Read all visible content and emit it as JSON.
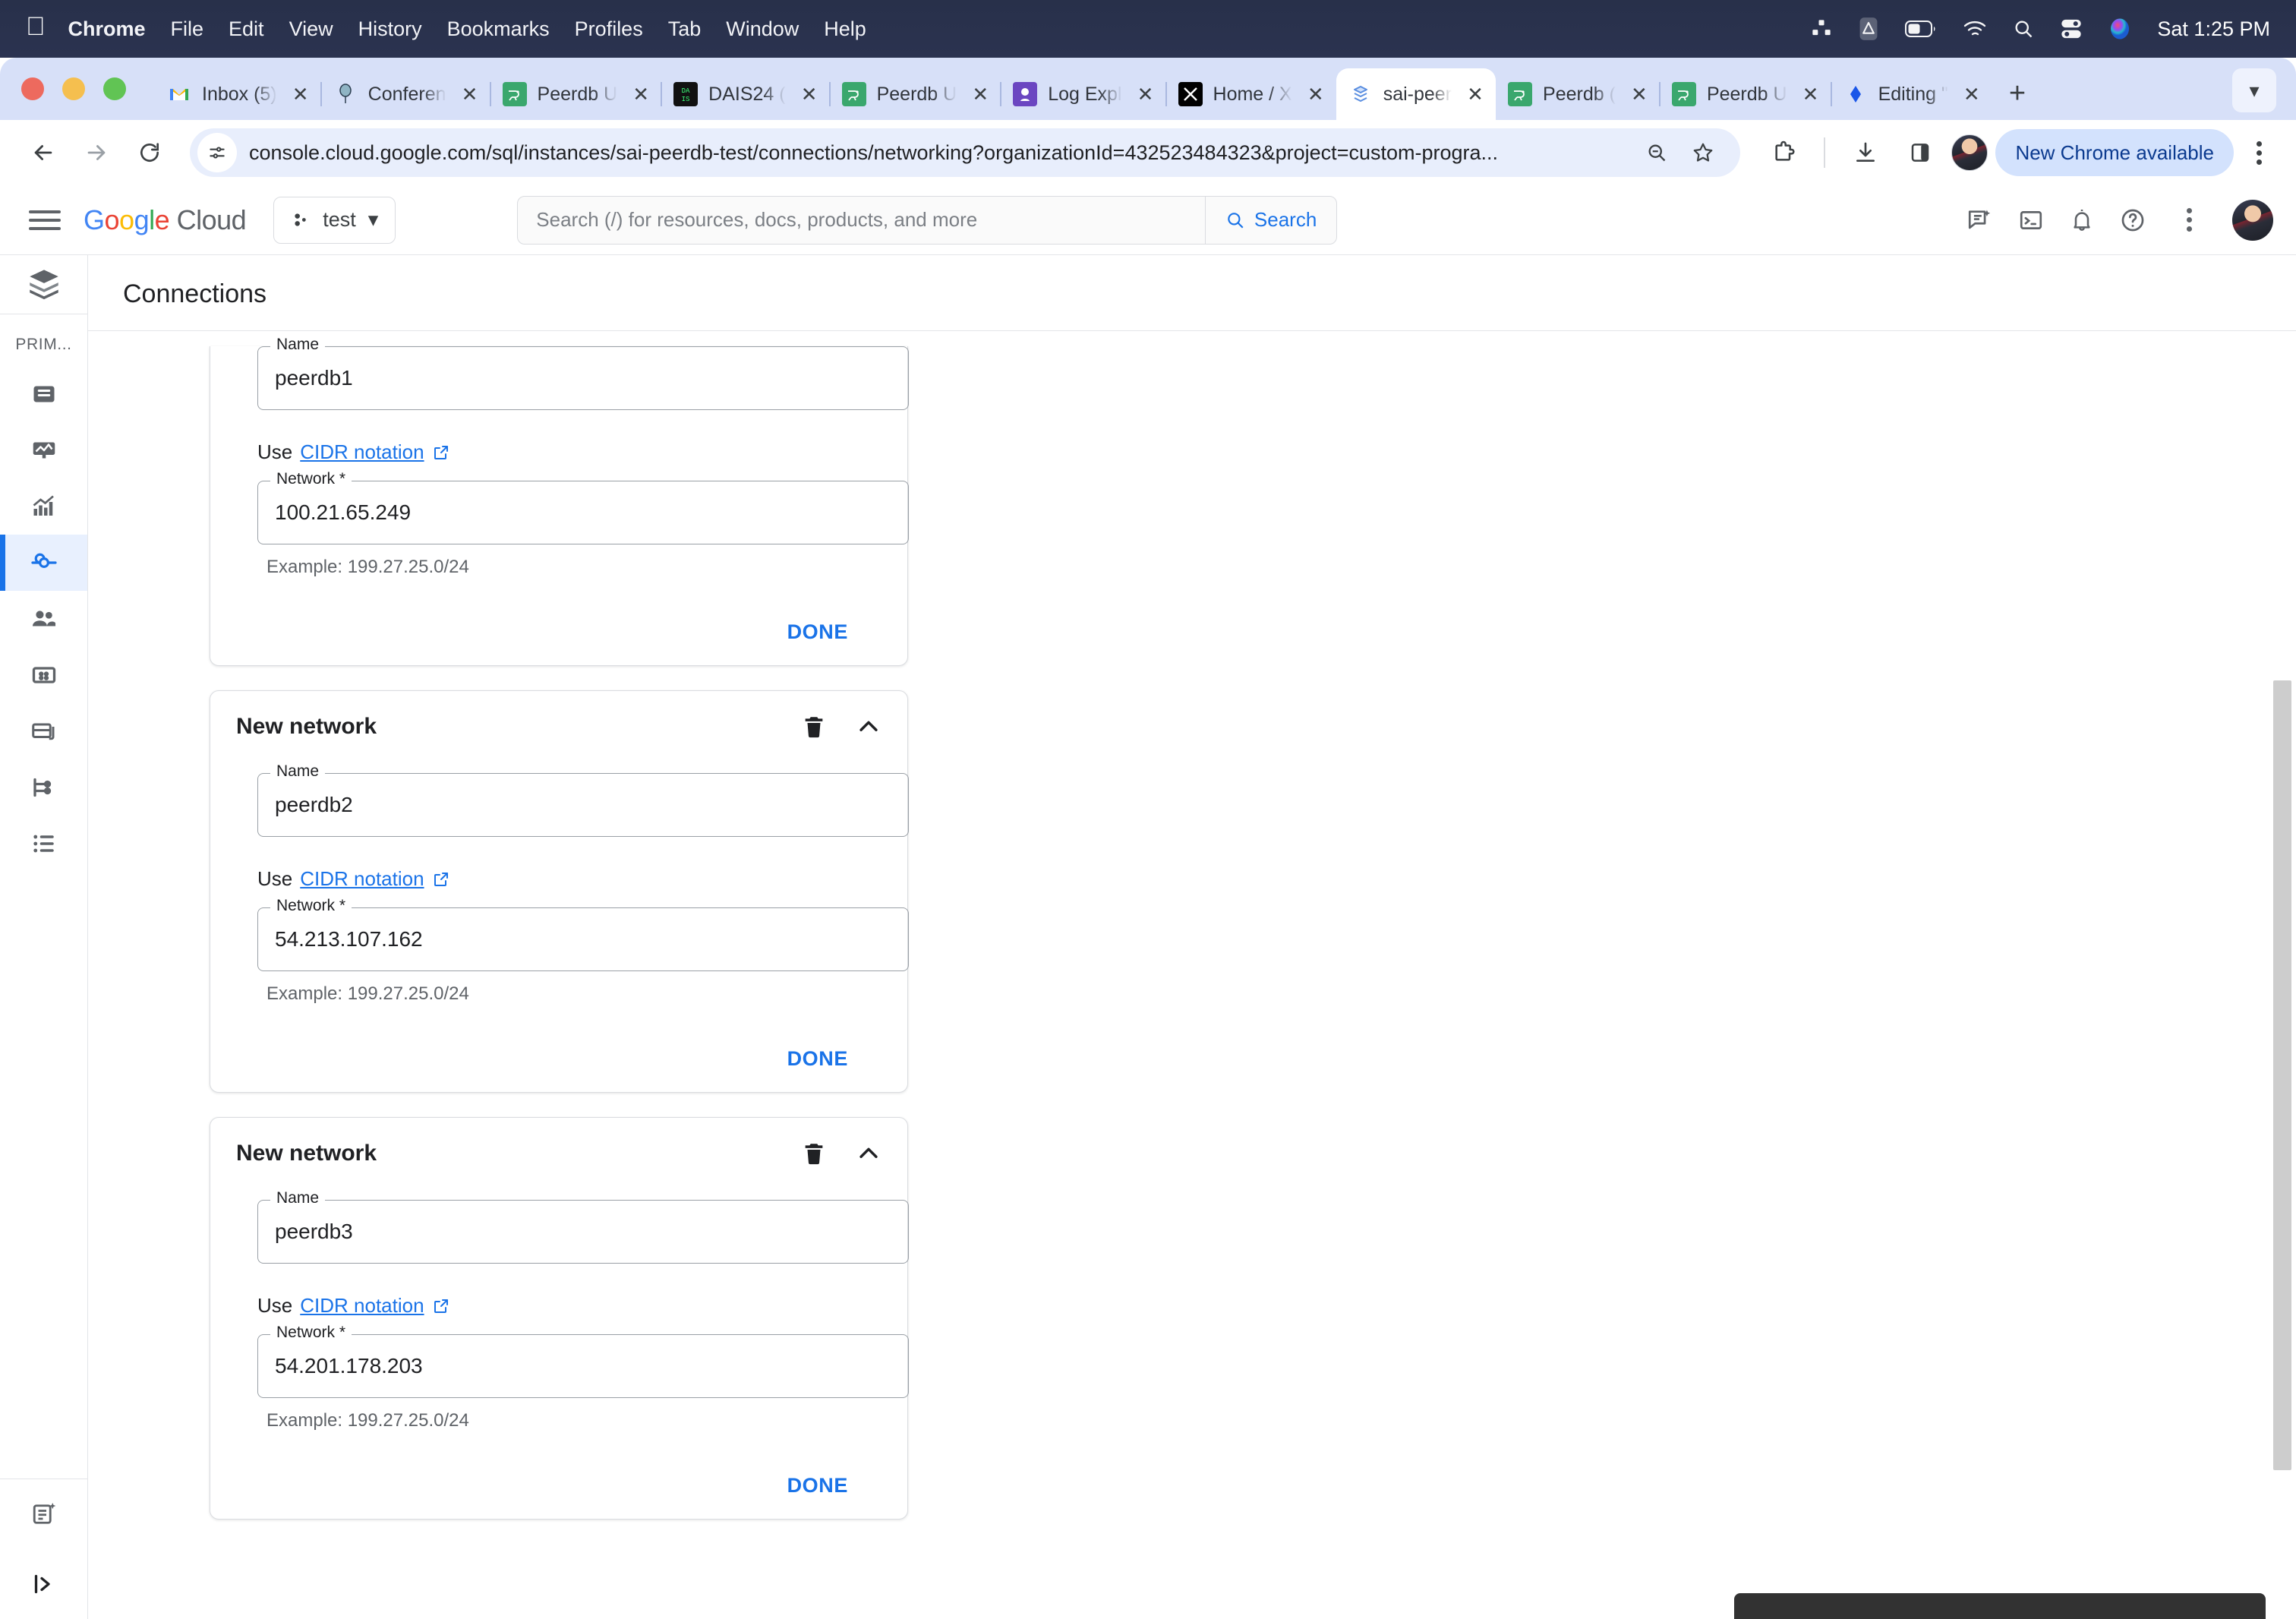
{
  "os_menubar": {
    "apple_icon": "apple-icon",
    "items": [
      "Chrome",
      "File",
      "Edit",
      "View",
      "History",
      "Bookmarks",
      "Profiles",
      "Tab",
      "Window",
      "Help"
    ],
    "status_icons": [
      "grid-icon",
      "app-icon",
      "battery-icon",
      "wifi-icon",
      "search-icon",
      "control-center-icon",
      "siri-icon"
    ],
    "clock": "Sat 1:25 PM"
  },
  "browser": {
    "traffic_lights": [
      "close-button",
      "minimize-button",
      "zoom-button"
    ],
    "tabs": [
      {
        "favicon": "gmail-icon",
        "label": "Inbox (5)",
        "active": false
      },
      {
        "favicon": "conference-icon",
        "label": "Conferen",
        "active": false
      },
      {
        "favicon": "peerdb-icon",
        "label": "Peerdb U",
        "active": false
      },
      {
        "favicon": "dais-icon",
        "label": "DAIS24 (",
        "active": false
      },
      {
        "favicon": "peerdb-icon",
        "label": "Peerdb U",
        "active": false
      },
      {
        "favicon": "logexplorer-icon",
        "label": "Log Expl",
        "active": false
      },
      {
        "favicon": "x-icon",
        "label": "Home / X",
        "active": false
      },
      {
        "favicon": "cloudsql-icon",
        "label": "sai-peer",
        "active": true
      },
      {
        "favicon": "peerdb-icon",
        "label": "Peerdb (",
        "active": false
      },
      {
        "favicon": "peerdb-icon",
        "label": "Peerdb U",
        "active": false
      },
      {
        "favicon": "editing-icon",
        "label": "Editing \"",
        "active": false
      }
    ],
    "new_tab_label": "+",
    "tab_list_chevron": "chevron-down-icon",
    "toolbar": {
      "back": "back-arrow-icon",
      "forward": "forward-arrow-icon",
      "reload": "reload-icon",
      "site_info": "site-settings-icon",
      "url": "console.cloud.google.com/sql/instances/sai-peerdb-test/connections/networking?organizationId=432523484323&project=custom-progra...",
      "zoom_icon": "zoom-out-icon",
      "bookmark_icon": "star-icon",
      "extensions_icon": "extensions-puzzle-icon",
      "downloads_icon": "download-icon",
      "sidepanel_icon": "side-panel-icon",
      "profile_icon": "profile-avatar",
      "update_label": "New Chrome available",
      "menu_icon": "kebab-menu-icon"
    }
  },
  "console_header": {
    "menu_icon": "hamburger-menu-icon",
    "logo": {
      "google": "Google",
      "cloud": "Cloud"
    },
    "project": {
      "icon": "project-icon",
      "name": "test",
      "chevron": "chevron-down-icon"
    },
    "search": {
      "placeholder": "Search (/) for resources, docs, products, and more",
      "button_label": "Search",
      "icon": "search-icon"
    },
    "right_icons": [
      "gemini-chat-icon",
      "cloud-shell-icon",
      "notifications-bell-icon",
      "help-question-icon",
      "kebab-menu-icon"
    ],
    "avatar": "user-avatar"
  },
  "sidebar": {
    "product_logo": "cloud-sql-icon",
    "section_label": "PRIM...",
    "items": [
      {
        "icon": "overview-icon",
        "name": "overview",
        "active": false
      },
      {
        "icon": "monitoring-icon",
        "name": "monitoring",
        "active": false
      },
      {
        "icon": "metrics-icon",
        "name": "metrics",
        "active": false
      },
      {
        "icon": "connections-icon",
        "name": "connections",
        "active": true
      },
      {
        "icon": "users-icon",
        "name": "users",
        "active": false
      },
      {
        "icon": "databases-icon",
        "name": "databases",
        "active": false
      },
      {
        "icon": "backups-icon",
        "name": "backups",
        "active": false
      },
      {
        "icon": "replicas-icon",
        "name": "replicas",
        "active": false
      },
      {
        "icon": "operations-icon",
        "name": "operations",
        "active": false
      }
    ],
    "bottom_items": [
      {
        "icon": "release-notes-icon",
        "name": "release-notes"
      },
      {
        "icon": "expand-panel-icon",
        "name": "expand-panel"
      }
    ]
  },
  "main": {
    "page_title": "Connections",
    "cards": [
      {
        "title": "",
        "clipped": true,
        "name_label": "Name",
        "name_value": "peerdb1",
        "cidr_prefix": "Use",
        "cidr_link": "CIDR notation",
        "network_label": "Network *",
        "network_value": "100.21.65.249",
        "hint": "Example: 199.27.25.0/24",
        "done_label": "DONE"
      },
      {
        "title": "New network",
        "clipped": false,
        "name_label": "Name",
        "name_value": "peerdb2",
        "cidr_prefix": "Use",
        "cidr_link": "CIDR notation",
        "network_label": "Network *",
        "network_value": "54.213.107.162",
        "hint": "Example: 199.27.25.0/24",
        "done_label": "DONE"
      },
      {
        "title": "New network",
        "clipped": false,
        "name_label": "Name",
        "name_value": "peerdb3",
        "cidr_prefix": "Use",
        "cidr_link": "CIDR notation",
        "network_label": "Network *",
        "network_value": "54.201.178.203",
        "hint": "Example: 199.27.25.0/24",
        "done_label": "DONE"
      }
    ],
    "card_icons": {
      "delete": "trash-icon",
      "collapse": "chevron-up-icon"
    }
  },
  "colors": {
    "accent_blue": "#1a73e8",
    "menubar_bg": "#2b3350",
    "tabstrip_bg": "#d7e0f8",
    "omnibox_bg": "#e8eefc",
    "active_rail_bg": "#e8f0fe"
  }
}
